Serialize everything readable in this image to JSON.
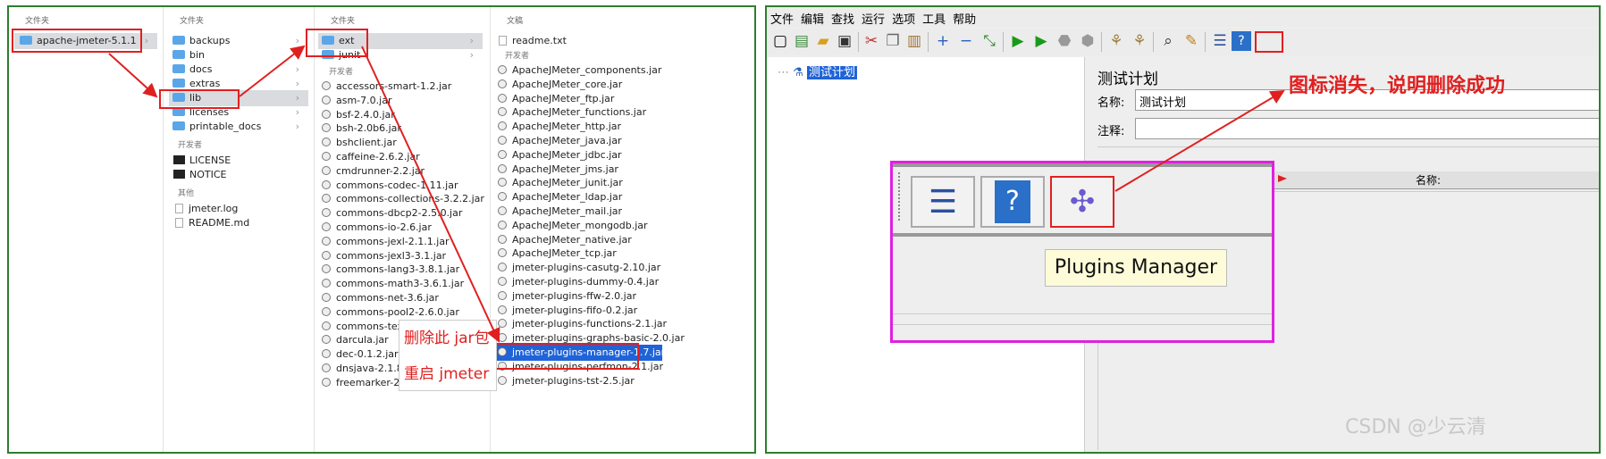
{
  "finder": {
    "col1": {
      "header": "文件夹",
      "items": [
        {
          "name": "apache-jmeter-5.1.1"
        }
      ]
    },
    "col2": {
      "header": "文件夹",
      "folders": [
        "backups",
        "bin",
        "docs",
        "extras",
        "lib",
        "licenses",
        "printable_docs"
      ],
      "group_dev": "开发者",
      "dev_items": [
        "LICENSE",
        "NOTICE"
      ],
      "group_other": "其他",
      "other_items": [
        "jmeter.log",
        "README.md"
      ]
    },
    "col3": {
      "header": "文件夹",
      "folders": [
        "ext",
        "junit"
      ],
      "group_dev": "开发者",
      "jars": [
        "accessors-smart-1.2.jar",
        "asm-7.0.jar",
        "bsf-2.4.0.jar",
        "bsh-2.0b6.jar",
        "bshclient.jar",
        "caffeine-2.6.2.jar",
        "cmdrunner-2.2.jar",
        "commons-codec-1.11.jar",
        "commons-collections-3.2.2.jar",
        "commons-dbcp2-2.5.0.jar",
        "commons-io-2.6.jar",
        "commons-jexl-2.1.1.jar",
        "commons-jexl3-3.1.jar",
        "commons-lang3-3.8.1.jar",
        "commons-math3-3.6.1.jar",
        "commons-net-3.6.jar",
        "commons-pool2-2.6.0.jar",
        "commons-text-1.6.jar",
        "darcula.jar",
        "dec-0.1.2.jar",
        "dnsjava-2.1.8.jar",
        "freemarker-2.3.28.jar"
      ]
    },
    "col4": {
      "header": "文稿",
      "doc": "readme.txt",
      "group_dev": "开发者",
      "jars": [
        "ApacheJMeter_components.jar",
        "ApacheJMeter_core.jar",
        "ApacheJMeter_ftp.jar",
        "ApacheJMeter_functions.jar",
        "ApacheJMeter_http.jar",
        "ApacheJMeter_java.jar",
        "ApacheJMeter_jdbc.jar",
        "ApacheJMeter_jms.jar",
        "ApacheJMeter_junit.jar",
        "ApacheJMeter_ldap.jar",
        "ApacheJMeter_mail.jar",
        "ApacheJMeter_mongodb.jar",
        "ApacheJMeter_native.jar",
        "ApacheJMeter_tcp.jar",
        "jmeter-plugins-casutg-2.10.jar",
        "jmeter-plugins-dummy-0.4.jar",
        "jmeter-plugins-ffw-2.0.jar",
        "jmeter-plugins-fifo-0.2.jar",
        "jmeter-plugins-functions-2.1.jar",
        "jmeter-plugins-graphs-basic-2.0.jar",
        "jmeter-plugins-manager-1.7.jar",
        "jmeter-plugins-perfmon-2.1.jar",
        "jmeter-plugins-tst-2.5.jar"
      ]
    }
  },
  "annotations": {
    "delete_jar": "删除此 jar包",
    "restart": "重启 jmeter",
    "icon_gone": "图标消失，说明删除成功"
  },
  "jmeter": {
    "menu": [
      "文件",
      "编辑",
      "查找",
      "运行",
      "选项",
      "工具",
      "帮助"
    ],
    "tree_root": "测试计划",
    "panel_title": "测试计划",
    "name_label": "名称:",
    "name_value": "测试计划",
    "comment_label": "注释:",
    "table_header": "名称:",
    "tooltip": "Plugins Manager"
  },
  "watermark": "CSDN @少云清",
  "colors": {
    "annotation_red": "#e02020",
    "frame_green": "#2e7d2e",
    "zoom_magenta": "#e020e0",
    "selection_blue": "#1f63d8"
  }
}
